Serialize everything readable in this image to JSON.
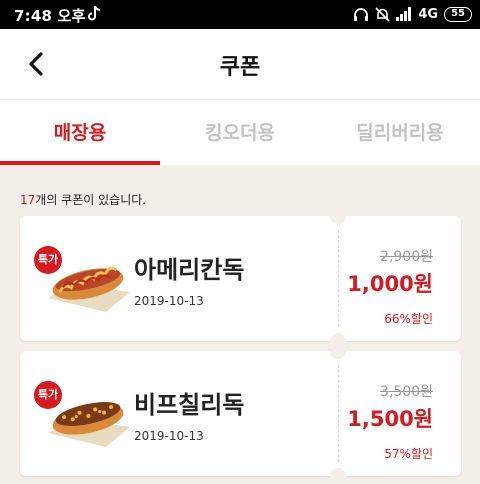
{
  "status_bar": {
    "time": "7:48 오후",
    "network": "4G",
    "battery": "55"
  },
  "header": {
    "title": "쿠폰"
  },
  "tabs": [
    {
      "label": "매장용",
      "active": true
    },
    {
      "label": "킹오더용",
      "active": false
    },
    {
      "label": "딜리버리용",
      "active": false
    }
  ],
  "coupon_count": {
    "number": "17",
    "suffix": "개의 쿠폰이 있습니다."
  },
  "coupons": [
    {
      "badge": "특가",
      "name": "아메리칸독",
      "date": "2019-10-13",
      "original_price": "2,900원",
      "price": "1,000원",
      "discount": "66%할인"
    },
    {
      "badge": "특가",
      "name": "비프칠리독",
      "date": "2019-10-13",
      "original_price": "3,500원",
      "price": "1,500원",
      "discount": "57%할인"
    }
  ],
  "colors": {
    "accent": "#d71920",
    "background": "#f5efe9"
  }
}
